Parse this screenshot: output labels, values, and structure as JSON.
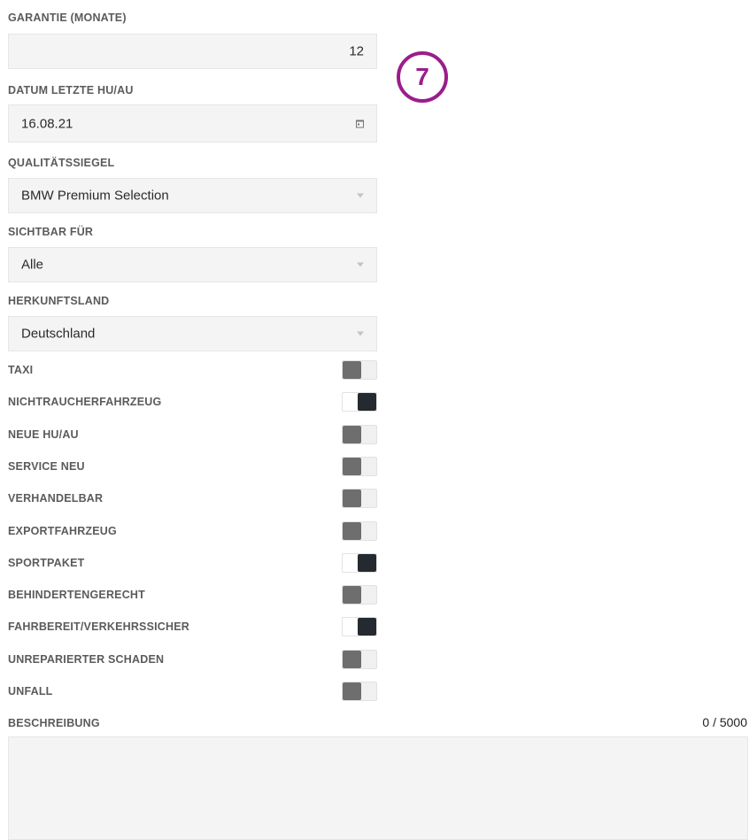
{
  "fields": {
    "garantie": {
      "label": "GARANTIE (MONATE)",
      "value": "12"
    },
    "datum": {
      "label": "DATUM LETZTE HU/AU",
      "value": "16.08.21"
    },
    "siegel": {
      "label": "QUALITÄTSSIEGEL",
      "value": "BMW Premium Selection"
    },
    "sichtbar": {
      "label": "SICHTBAR FÜR",
      "value": "Alle"
    },
    "herkunft": {
      "label": "HERKUNFTSLAND",
      "value": "Deutschland"
    }
  },
  "annotation": {
    "badge_number": "7",
    "badge_color": "#9b1d8a"
  },
  "toggles": [
    {
      "label": "TAXI",
      "on": false
    },
    {
      "label": "NICHTRAUCHERFAHRZEUG",
      "on": true
    },
    {
      "label": "NEUE HU/AU",
      "on": false
    },
    {
      "label": "SERVICE NEU",
      "on": false
    },
    {
      "label": "VERHANDELBAR",
      "on": false
    },
    {
      "label": "EXPORTFAHRZEUG",
      "on": false
    },
    {
      "label": "SPORTPAKET",
      "on": true
    },
    {
      "label": "BEHINDERTENGERECHT",
      "on": false
    },
    {
      "label": "FAHRBEREIT/VERKEHRSSICHER",
      "on": true
    },
    {
      "label": "UNREPARIERTER SCHADEN",
      "on": false
    },
    {
      "label": "UNFALL",
      "on": false
    }
  ],
  "beschreibung": {
    "label": "BESCHREIBUNG",
    "counter": "0 / 5000",
    "value": ""
  },
  "colors": {
    "toggle_on": "#252a31",
    "toggle_off": "#6e6e6e",
    "field_bg": "#f4f4f4"
  }
}
